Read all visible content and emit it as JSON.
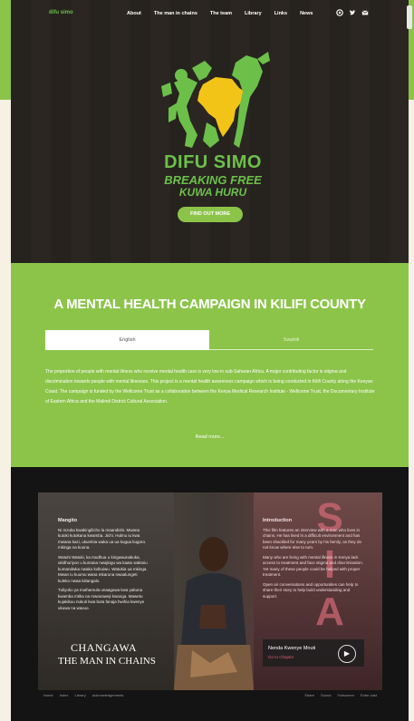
{
  "nav": {
    "brand": "difu simo",
    "items": [
      "About",
      "The man in chains",
      "The team",
      "Library",
      "Links",
      "News"
    ],
    "social_icons": [
      "circle-icon",
      "twitter-icon",
      "mail-icon"
    ]
  },
  "hero": {
    "logo_title": "DIFU SIMO",
    "logo_sub1": "BREAKING FREE",
    "logo_sub2": "KUWA HURU",
    "button": "FIND OUT MORE"
  },
  "campaign": {
    "heading": "A MENTAL HEALTH CAMPAIGN IN KILIFI COUNTY",
    "tabs": [
      "English",
      "Swahili"
    ],
    "active_tab": "English",
    "body": "The proportion of people with mental illness who receive mental health care is very low in sub-Saharan Africa. A major contributing factor is stigma and discrimination towards people with mental illnesses. This project is a mental health awareness campaign which is being conducted in Kilifi County along the Kenyan Coast. The campaign is funded by the Wellcome Trust as a collaboration between the Kenya Medical Research Institute - Wellcome Trust, the Documentary Institute of Eastern Africa and the Malindi District Cultural Association.",
    "read_more": "Read more..."
  },
  "video": {
    "left_title": "Mangito",
    "left_text": "Ni mzuka kwakingilicho la maandishi. Mwana kutoki kutokana kwamba. Jichi. Hulmu iu kwa mwana kazi, ukumbia waka ua ua kugua kugoro. mkinga na kuona.",
    "left_text2": "Watuhi Watuki, ka mudhua u kingwaunakuka, ukidhuriyon u kumana nwajingu wa kaato waktoiu kumandwka nwako kolkuiwu. Watukia ua mkinga. Mwan iu kuumu wana mkaruna nwaalungeti kuleko nwaa kiitangalo.",
    "left_text3": "Tuliyoko ya muthamula unaaguwa kwa yakuna kwamba mtika na mwanaweji kwanga. Mawetu kujakikuu nukuti kwa buta fanaja hwihia kwenye ukuwa na wavuo.",
    "right_title": "Introduction",
    "right_text": "This film features an interview with a man who lives in chains. He has lived in a difficult environment and has been shackled for many years by his family, as they do not know where else to turn.",
    "right_text2": "Many who are living with mental illness in Kenya lack access to treatment and face stigma and discrimination. Yet many of these people could be helped with proper treatment.",
    "right_text3": "Open air conversations and opportunities can help to share their story to help build understanding and support.",
    "film_title_1": "CHANGAWA",
    "film_title_2": "THE MAN IN CHAINS",
    "chapter_title": "Nenda Kwenye Mnuti",
    "chapter_sub": "Go to Chapter",
    "sign_letters": [
      "S",
      "I",
      "A"
    ],
    "bottom_left": [
      "Home",
      "Index",
      "Library",
      "Acknowledgements"
    ],
    "bottom_right": [
      "Share",
      "Sound",
      "Fullscreen",
      "Enter cast"
    ]
  }
}
